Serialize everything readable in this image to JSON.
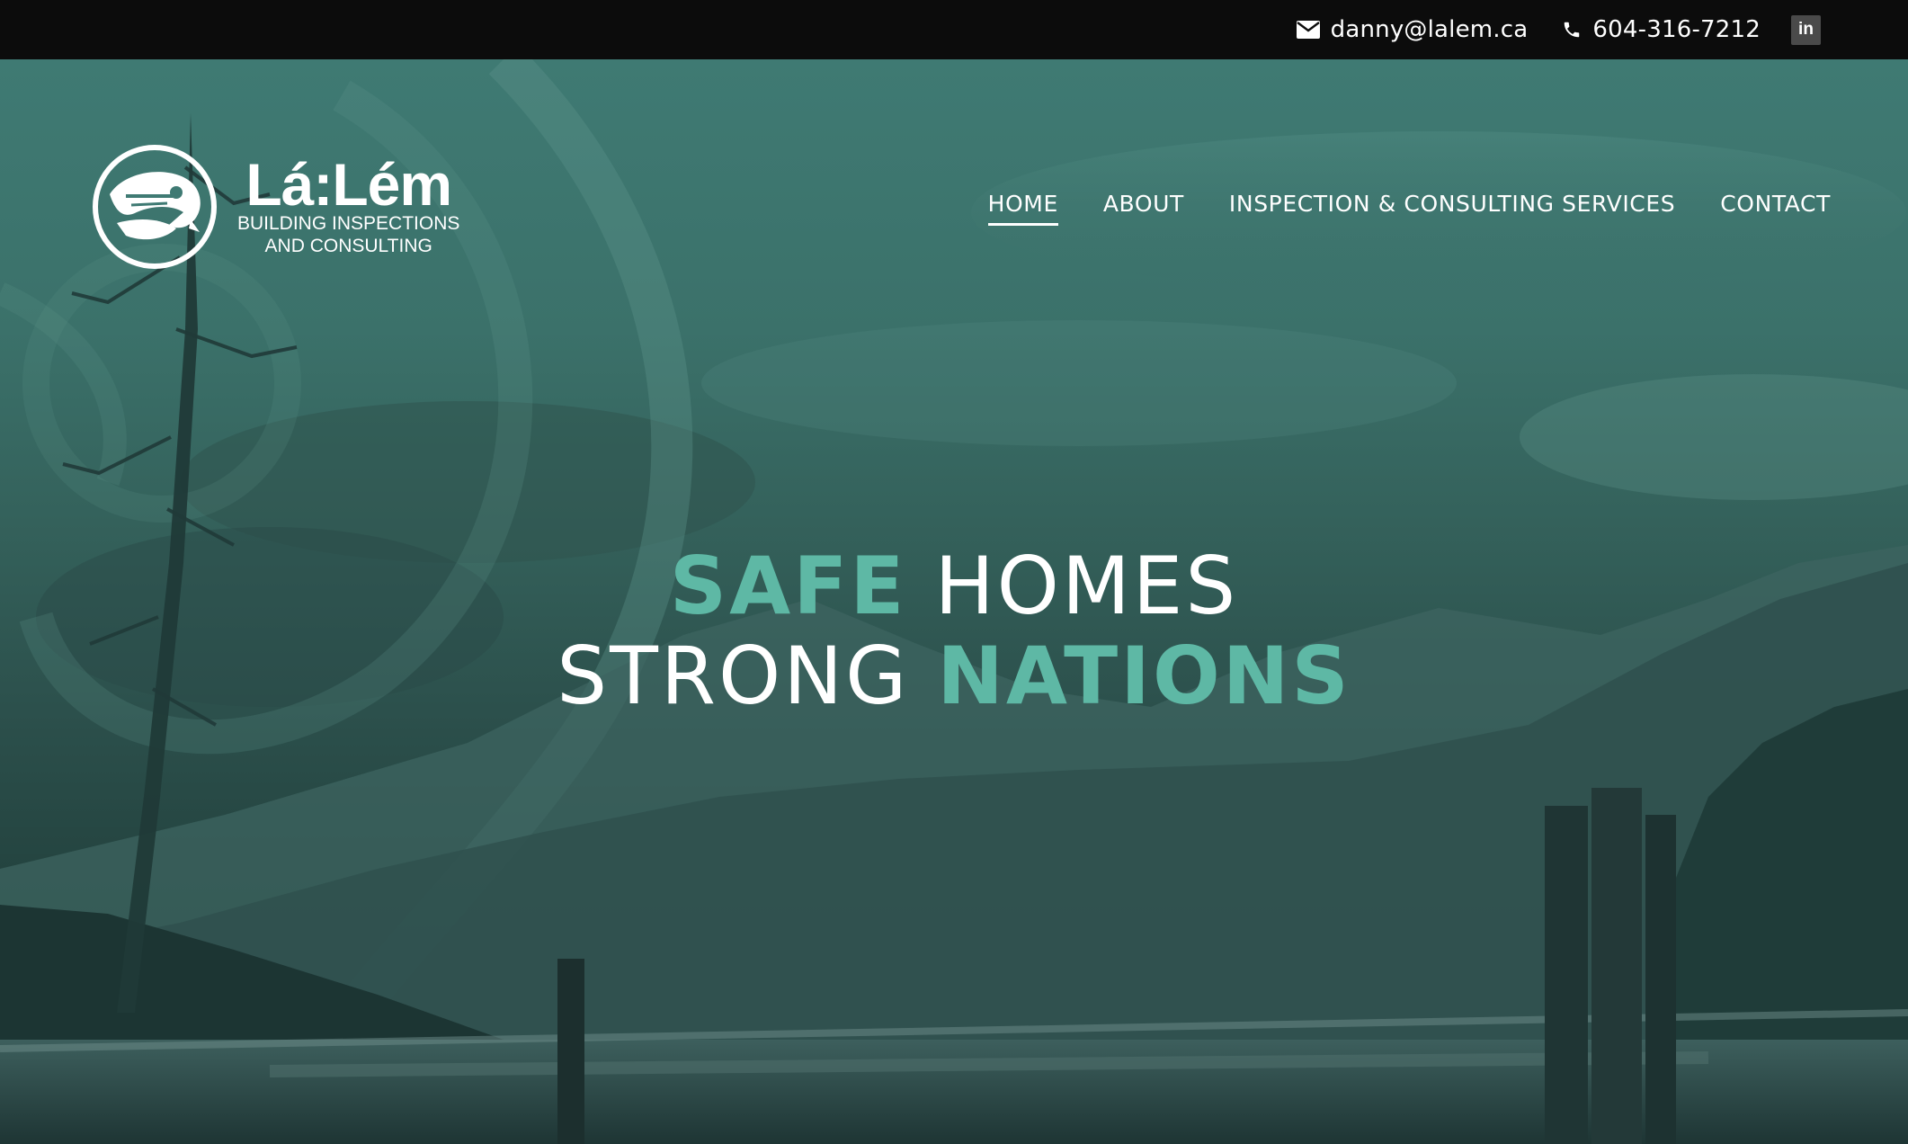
{
  "topbar": {
    "email": "danny@lalem.ca",
    "phone": "604-316-7212",
    "linkedin_label": "in"
  },
  "logo": {
    "brand": "Lá:Lém",
    "subtitle_line1": "BUILDING INSPECTIONS",
    "subtitle_line2": "AND CONSULTING"
  },
  "nav": {
    "items": [
      {
        "label": "HOME",
        "active": true
      },
      {
        "label": "ABOUT",
        "active": false
      },
      {
        "label": "INSPECTION & CONSULTING SERVICES",
        "active": false
      },
      {
        "label": "CONTACT",
        "active": false
      }
    ]
  },
  "hero": {
    "line1_accent": "SAFE",
    "line1_rest": "HOMES",
    "line2_rest": "STRONG",
    "line2_accent": "NATIONS"
  },
  "colors": {
    "accent": "#5eb8a5",
    "topbar_bg": "#0c0c0c",
    "overlay": "#3f7a73"
  },
  "icons": [
    "envelope-icon",
    "phone-icon",
    "linkedin-icon",
    "eagle-emblem-icon"
  ]
}
